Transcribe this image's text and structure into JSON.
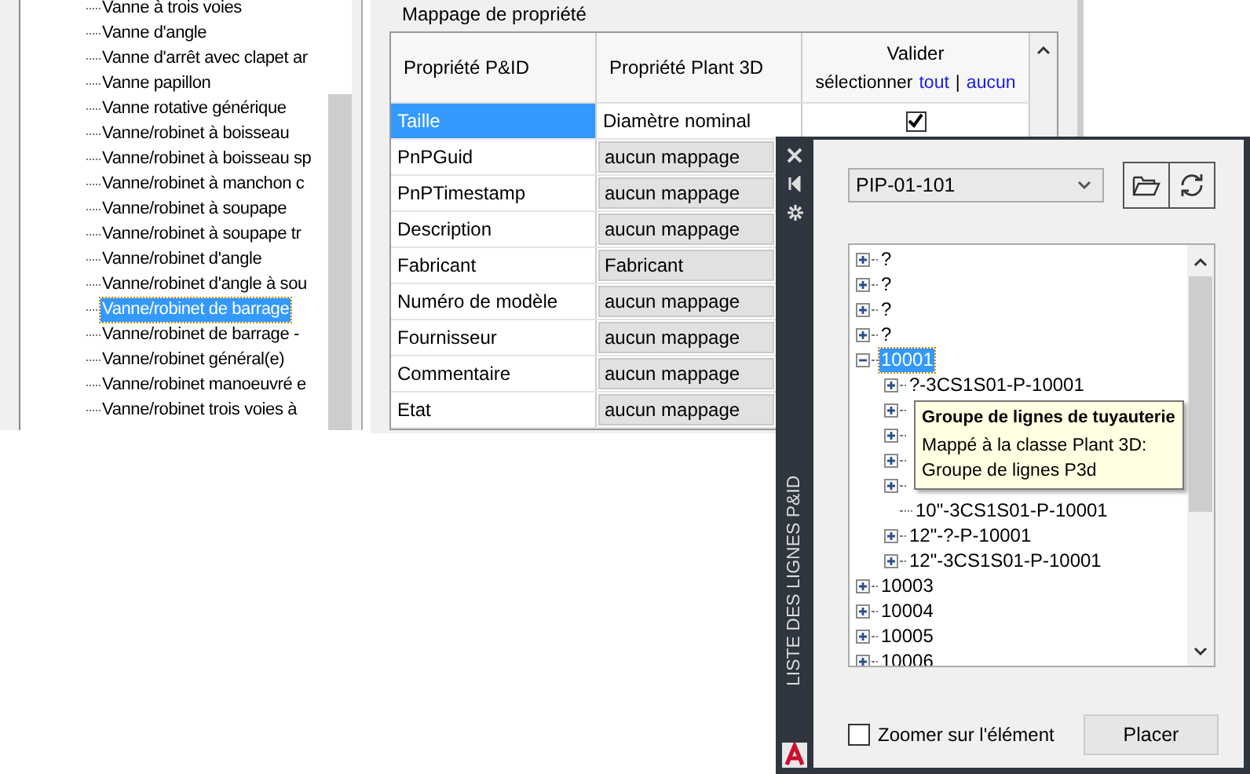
{
  "class_tree": {
    "items": [
      {
        "label": "Vanne à trois voies",
        "selected": false
      },
      {
        "label": "Vanne d'angle",
        "selected": false
      },
      {
        "label": "Vanne d'arrêt avec clapet ar",
        "selected": false
      },
      {
        "label": "Vanne papillon",
        "selected": false
      },
      {
        "label": "Vanne rotative générique",
        "selected": false
      },
      {
        "label": "Vanne/robinet à boisseau",
        "selected": false
      },
      {
        "label": "Vanne/robinet à boisseau sp",
        "selected": false
      },
      {
        "label": "Vanne/robinet à manchon c",
        "selected": false
      },
      {
        "label": "Vanne/robinet à soupape",
        "selected": false
      },
      {
        "label": "Vanne/robinet à soupape tr",
        "selected": false
      },
      {
        "label": "Vanne/robinet d'angle",
        "selected": false
      },
      {
        "label": "Vanne/robinet d'angle à sou",
        "selected": false
      },
      {
        "label": "Vanne/robinet de barrage",
        "selected": true
      },
      {
        "label": "Vanne/robinet de barrage -",
        "selected": false
      },
      {
        "label": "Vanne/robinet général(e)",
        "selected": false
      },
      {
        "label": "Vanne/robinet manoeuvré e",
        "selected": false
      },
      {
        "label": "Vanne/robinet trois voies à",
        "selected": false
      }
    ]
  },
  "mapping": {
    "title": "Mappage de propriété",
    "columns": [
      "Propriété P&ID",
      "Propriété Plant 3D"
    ],
    "validate": {
      "label": "Valider",
      "prefix": "sélectionner",
      "all_link": "tout",
      "separator": "|",
      "none_link": "aucun"
    },
    "rows": [
      {
        "pid": "Taille",
        "plant": "Diamètre nominal",
        "selected": true,
        "mapped": true,
        "checked": true
      },
      {
        "pid": "PnPGuid",
        "plant": "aucun mappage",
        "selected": false,
        "mapped": false
      },
      {
        "pid": "PnPTimestamp",
        "plant": "aucun mappage",
        "selected": false,
        "mapped": false
      },
      {
        "pid": "Description",
        "plant": "aucun mappage",
        "selected": false,
        "mapped": false
      },
      {
        "pid": "Fabricant",
        "plant": "Fabricant",
        "selected": false,
        "mapped": false
      },
      {
        "pid": "Numéro de modèle",
        "plant": "aucun mappage",
        "selected": false,
        "mapped": false
      },
      {
        "pid": "Fournisseur",
        "plant": "aucun mappage",
        "selected": false,
        "mapped": false
      },
      {
        "pid": "Commentaire",
        "plant": "aucun mappage",
        "selected": false,
        "mapped": false
      },
      {
        "pid": "Etat",
        "plant": "aucun mappage",
        "selected": false,
        "mapped": false
      }
    ]
  },
  "palette": {
    "title": "LISTE DES LIGNES P&ID",
    "drawing": "PIP-01-101",
    "tree": [
      {
        "label": "?",
        "expanded": false,
        "selected": false
      },
      {
        "label": "?",
        "expanded": false,
        "selected": false
      },
      {
        "label": "?",
        "expanded": false,
        "selected": false
      },
      {
        "label": "?",
        "expanded": false,
        "selected": false
      },
      {
        "label": "10001",
        "expanded": true,
        "selected": true,
        "children": [
          {
            "label": "?-3CS1S01-P-10001",
            "expanded": false,
            "selected": false
          },
          {
            "expanded": false
          },
          {
            "expanded": false
          },
          {
            "expanded": false
          },
          {
            "expanded": false
          },
          {
            "label": "10\"-3CS1S01-P-10001",
            "selected": false
          },
          {
            "label": "12\"-?-P-10001",
            "expanded": false,
            "selected": false
          },
          {
            "label": "12\"-3CS1S01-P-10001",
            "expanded": false,
            "selected": false
          }
        ]
      },
      {
        "label": "10003",
        "expanded": false,
        "selected": false
      },
      {
        "label": "10004",
        "expanded": false,
        "selected": false
      },
      {
        "label": "10005",
        "expanded": false,
        "selected": false
      },
      {
        "label": "10006",
        "expanded": false,
        "selected": false
      }
    ],
    "tooltip": {
      "title": "Groupe de lignes de tuyauterie",
      "lines": [
        "Mappé à la classe Plant 3D:",
        "Groupe de lignes P3d"
      ]
    },
    "zoom_checkbox": {
      "label": "Zoomer sur l'élément",
      "checked": false
    },
    "place_button": "Placer"
  }
}
